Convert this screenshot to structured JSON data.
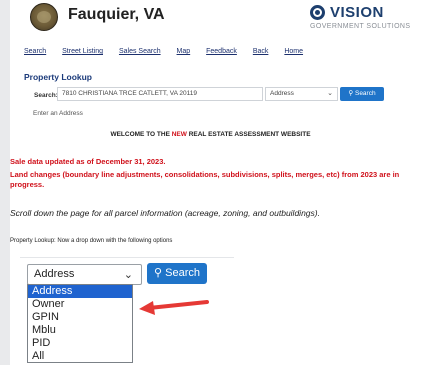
{
  "header": {
    "title": "Fauquier, VA",
    "logo_word": "VISION",
    "logo_sub": "GOVERNMENT SOLUTIONS"
  },
  "nav": [
    "Search",
    "Street Listing",
    "Sales Search",
    "Map",
    "Feedback",
    "Back",
    "Home"
  ],
  "section_title": "Property Lookup",
  "search": {
    "label": "Search:",
    "value": "7810 CHRISTIANA TRCE CATLETT, VA 20119",
    "type_selected": "Address",
    "button": "Search",
    "hint": "Enter an Address"
  },
  "welcome": {
    "before": "WELCOME TO THE ",
    "new": "NEW",
    "after": " REAL ESTATE ASSESSMENT WEBSITE"
  },
  "notices": {
    "sale_data": "Sale data updated as of December 31, 2023.",
    "land_changes": "Land changes (boundary line adjustments, consolidations, subdivisions, splits, merges, etc) from 2023 are in progress."
  },
  "scroll_note": "Scroll down the page for all parcel information (acreage, zoning, and outbuildings).",
  "lookup_note": "Property Lookup:  Now a drop down with the following options",
  "zoom_search": {
    "selected": "Address",
    "button": "Search",
    "options": [
      "Address",
      "Owner",
      "GPIN",
      "Mblu",
      "PID",
      "All"
    ]
  },
  "colors": {
    "accent": "#1f74c9",
    "alert": "#d0111b",
    "highlight": "#1f63cf"
  }
}
